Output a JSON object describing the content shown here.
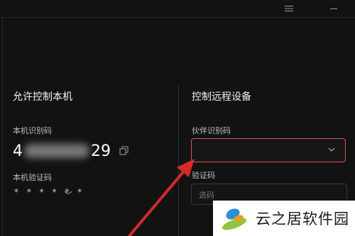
{
  "titlebar": {
    "menu_icon": "menu-icon",
    "min_icon": "minimize-icon"
  },
  "left": {
    "title": "允许控制本机",
    "id_label": "本机识别码",
    "id_start": "4",
    "id_end": "29",
    "code_label": "本机验证码",
    "code_value": "* * * * * *"
  },
  "right": {
    "title": "控制远程设备",
    "partner_label": "伙伴识别码",
    "partner_value": "",
    "verify_label": "验证码",
    "verify_placeholder": "选码"
  },
  "watermark": {
    "text": "云之居软件园"
  },
  "colors": {
    "accent": "#e05055",
    "background": "#121212",
    "arrow": "#d42a2a"
  }
}
